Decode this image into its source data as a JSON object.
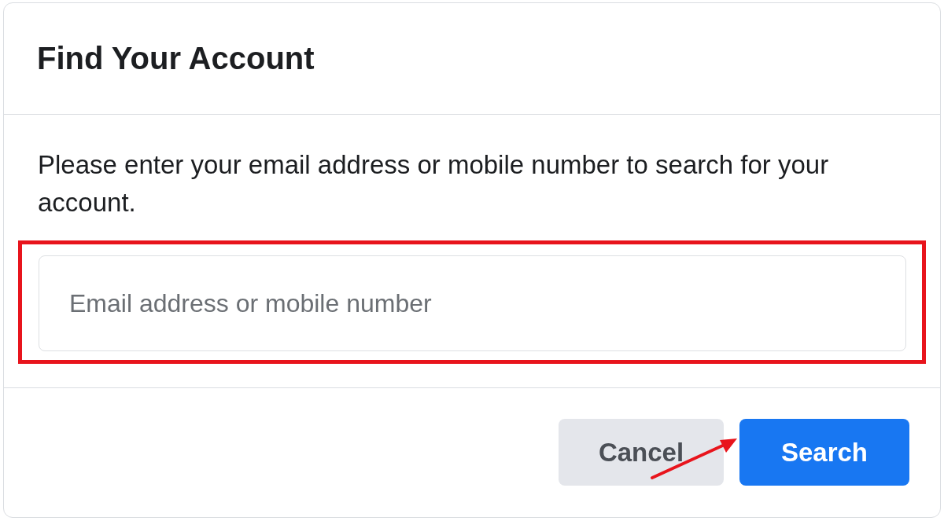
{
  "dialog": {
    "title": "Find Your Account",
    "message": "Please enter your email address or mobile number to search for your account.",
    "field": {
      "placeholder": "Email address or mobile number"
    },
    "buttons": [
      {
        "label": "Cancel",
        "kind": "secondary"
      },
      {
        "label": "Search",
        "kind": "primary"
      }
    ]
  }
}
